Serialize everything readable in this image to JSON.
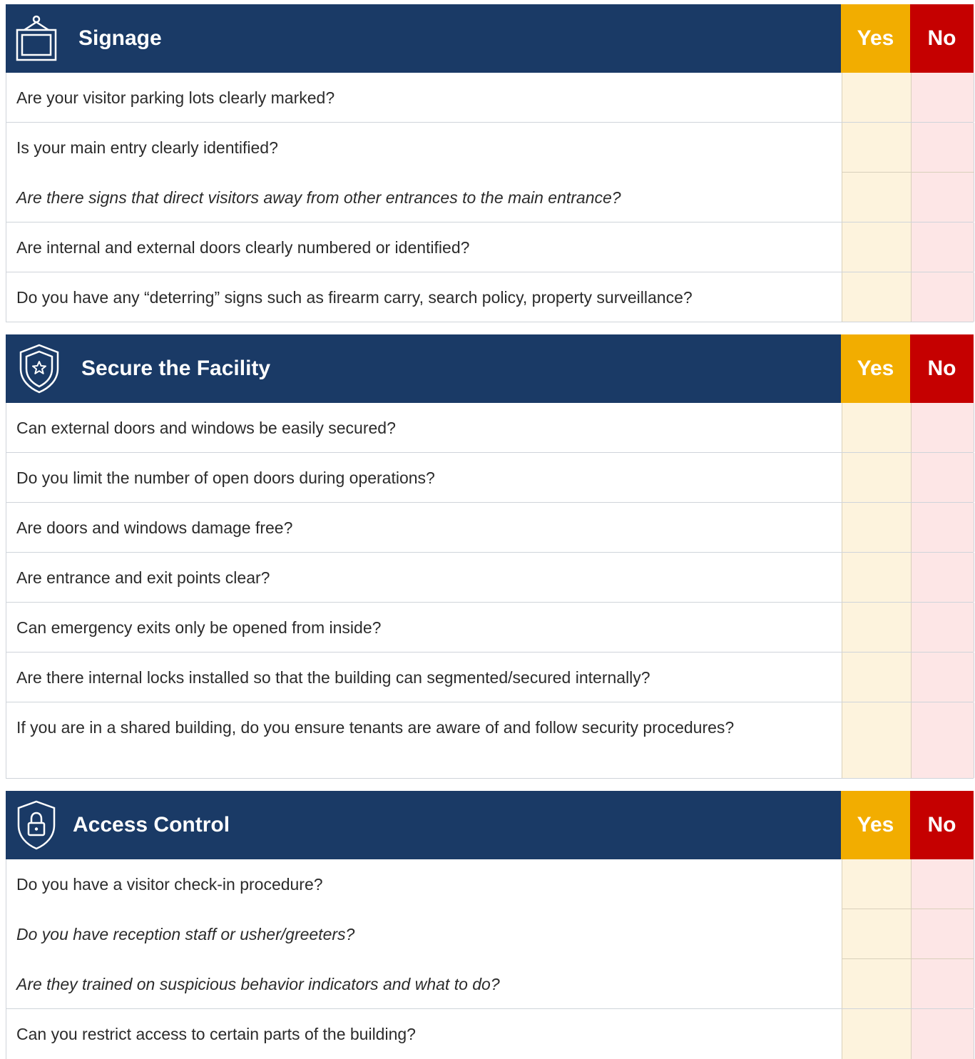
{
  "columns": {
    "yes": "Yes",
    "no": "No"
  },
  "sections": [
    {
      "title": "Signage",
      "icon": "framed-sign-icon",
      "questions": [
        "Are your visitor parking lots clearly marked?",
        "Is your main entry clearly identified?",
        "Are there signs that direct visitors away from other entrances to the main entrance?",
        "Are internal and external doors clearly numbered or identified?",
        "Do you have any “deterring” signs such as firearm carry, search policy, property surveillance?"
      ]
    },
    {
      "title": "Secure the Facility",
      "icon": "shield-star-icon",
      "questions": [
        "Can external doors and windows be easily secured?",
        "Do you limit the number of open doors during operations?",
        "Are doors and windows damage free?",
        "Are entrance and exit points clear?",
        "Can emergency exits only be opened from inside?",
        "Are there internal locks installed so that the building can segmented/secured internally?",
        "If you are in a shared building, do you ensure tenants are aware of and follow security procedures?"
      ]
    },
    {
      "title": "Access Control",
      "icon": "shield-lock-icon",
      "questions": [
        "Do you have a visitor check-in procedure?",
        "Do you have reception staff or usher/greeters?",
        "Are they trained on suspicious behavior indicators and what to do?",
        "Can you restrict access to certain parts of the building?"
      ]
    }
  ]
}
